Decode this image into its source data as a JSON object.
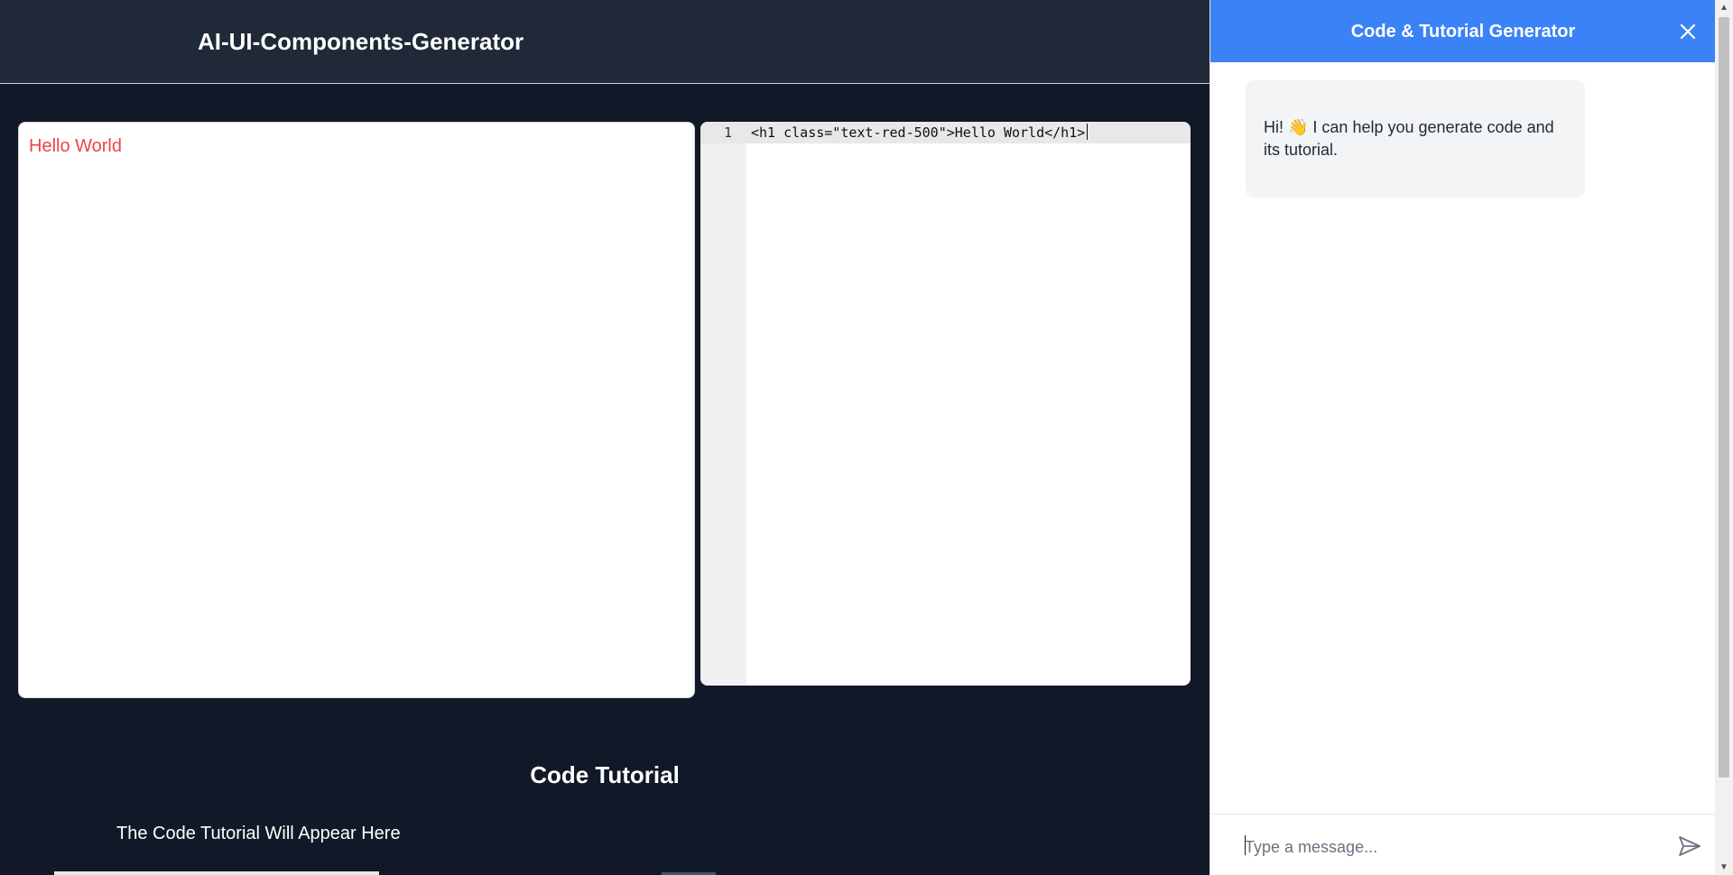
{
  "header": {
    "title": "AI-UI-Components-Generator"
  },
  "preview": {
    "rendered_heading": "Hello World"
  },
  "editor": {
    "lines": [
      {
        "number": "1",
        "code": "<h1 class=\"text-red-500\">Hello World</h1>"
      }
    ]
  },
  "tutorial": {
    "title": "Code Tutorial",
    "body": "The Code Tutorial Will Appear Here"
  },
  "chat": {
    "title": "Code & Tutorial Generator",
    "close_icon": "close-icon",
    "messages": [
      {
        "from": "bot",
        "text": "Hi! 👋 I can help you generate code and its tutorial."
      }
    ],
    "input": {
      "value": "",
      "placeholder": "Type a message..."
    },
    "send_icon": "send-icon"
  },
  "colors": {
    "background": "#111827",
    "header_bg": "#1f2937",
    "chat_header": "#3b82f6",
    "preview_text": "#ef4444"
  }
}
